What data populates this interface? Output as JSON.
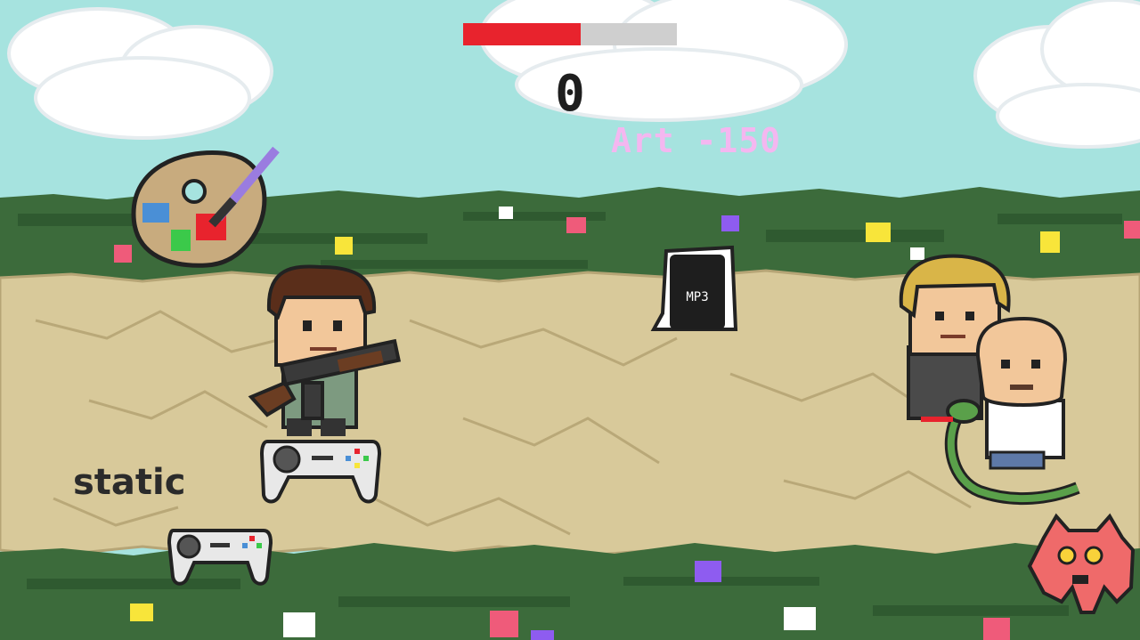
{
  "hud": {
    "health_fraction": 0.55,
    "health_color": "#e8232d",
    "score": "0",
    "popup_text": "Art -150"
  },
  "labels": {
    "static_text": "static"
  },
  "sprites": {
    "paint_palette": "palette-icon",
    "mp3_pickup": "mp3-file-icon",
    "gamepad": "gamepad-icon",
    "enemy": "pixel-monster"
  },
  "colors": {
    "sky": "#a6e3df",
    "grass": "#3c6b3b",
    "path": "#d8c99a",
    "accent_red": "#e8232d"
  }
}
